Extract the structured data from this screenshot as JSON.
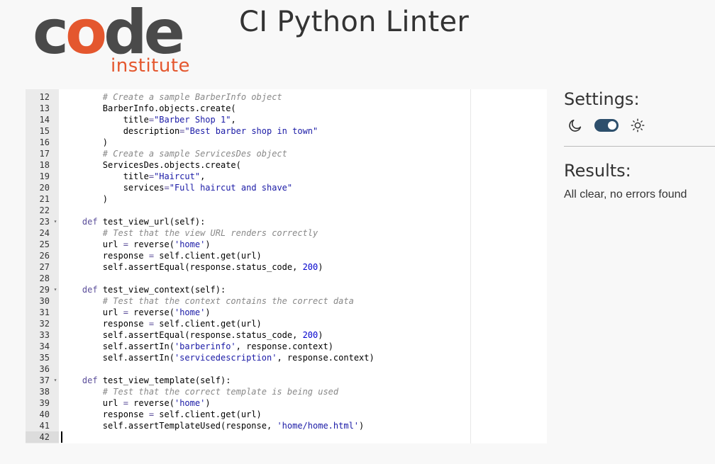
{
  "logo": {
    "word_code_prefix": "c",
    "word_code_o": "o",
    "word_code_suffix": "de",
    "word_institute": "institute"
  },
  "title": "CI Python Linter",
  "settings": {
    "heading": "Settings:",
    "dark_icon": "moon-icon",
    "light_icon": "sun-icon",
    "theme_toggle_on": true
  },
  "results": {
    "heading": "Results:",
    "message": "All clear, no errors found"
  },
  "editor": {
    "active_line": "42",
    "lines": [
      {
        "n": "12",
        "fold": "",
        "tokens": [
          {
            "t": "        "
          },
          {
            "c": "cmt",
            "t": "# Create a sample BarberInfo object"
          }
        ]
      },
      {
        "n": "13",
        "fold": "",
        "tokens": [
          {
            "t": "        BarberInfo.objects.create("
          }
        ]
      },
      {
        "n": "14",
        "fold": "",
        "tokens": [
          {
            "t": "            title"
          },
          {
            "c": "kw",
            "t": "="
          },
          {
            "c": "str",
            "t": "\"Barber Shop 1\""
          },
          {
            "t": ","
          }
        ]
      },
      {
        "n": "15",
        "fold": "",
        "tokens": [
          {
            "t": "            description"
          },
          {
            "c": "kw",
            "t": "="
          },
          {
            "c": "str",
            "t": "\"Best barber shop in town\""
          }
        ]
      },
      {
        "n": "16",
        "fold": "",
        "tokens": [
          {
            "t": "        )"
          }
        ]
      },
      {
        "n": "17",
        "fold": "",
        "tokens": [
          {
            "t": "        "
          },
          {
            "c": "cmt",
            "t": "# Create a sample ServicesDes object"
          }
        ]
      },
      {
        "n": "18",
        "fold": "",
        "tokens": [
          {
            "t": "        ServicesDes.objects.create("
          }
        ]
      },
      {
        "n": "19",
        "fold": "",
        "tokens": [
          {
            "t": "            title"
          },
          {
            "c": "kw",
            "t": "="
          },
          {
            "c": "str",
            "t": "\"Haircut\""
          },
          {
            "t": ","
          }
        ]
      },
      {
        "n": "20",
        "fold": "",
        "tokens": [
          {
            "t": "            services"
          },
          {
            "c": "kw",
            "t": "="
          },
          {
            "c": "str",
            "t": "\"Full haircut and shave\""
          }
        ]
      },
      {
        "n": "21",
        "fold": "",
        "tokens": [
          {
            "t": "        )"
          }
        ]
      },
      {
        "n": "22",
        "fold": "",
        "tokens": [
          {
            "t": ""
          }
        ]
      },
      {
        "n": "23",
        "fold": "▾",
        "tokens": [
          {
            "t": "    "
          },
          {
            "c": "kw",
            "t": "def"
          },
          {
            "t": " test_view_url(self):"
          }
        ]
      },
      {
        "n": "24",
        "fold": "",
        "tokens": [
          {
            "t": "        "
          },
          {
            "c": "cmt",
            "t": "# Test that the view URL renders correctly"
          }
        ]
      },
      {
        "n": "25",
        "fold": "",
        "tokens": [
          {
            "t": "        url "
          },
          {
            "c": "kw",
            "t": "="
          },
          {
            "t": " reverse("
          },
          {
            "c": "str",
            "t": "'home'"
          },
          {
            "t": ")"
          }
        ]
      },
      {
        "n": "26",
        "fold": "",
        "tokens": [
          {
            "t": "        response "
          },
          {
            "c": "kw",
            "t": "="
          },
          {
            "t": " self.client.get(url)"
          }
        ]
      },
      {
        "n": "27",
        "fold": "",
        "tokens": [
          {
            "t": "        self.assertEqual(response.status_code, "
          },
          {
            "c": "num",
            "t": "200"
          },
          {
            "t": ")"
          }
        ]
      },
      {
        "n": "28",
        "fold": "",
        "tokens": [
          {
            "t": ""
          }
        ]
      },
      {
        "n": "29",
        "fold": "▾",
        "tokens": [
          {
            "t": "    "
          },
          {
            "c": "kw",
            "t": "def"
          },
          {
            "t": " test_view_context(self):"
          }
        ]
      },
      {
        "n": "30",
        "fold": "",
        "tokens": [
          {
            "t": "        "
          },
          {
            "c": "cmt",
            "t": "# Test that the context contains the correct data"
          }
        ]
      },
      {
        "n": "31",
        "fold": "",
        "tokens": [
          {
            "t": "        url "
          },
          {
            "c": "kw",
            "t": "="
          },
          {
            "t": " reverse("
          },
          {
            "c": "str",
            "t": "'home'"
          },
          {
            "t": ")"
          }
        ]
      },
      {
        "n": "32",
        "fold": "",
        "tokens": [
          {
            "t": "        response "
          },
          {
            "c": "kw",
            "t": "="
          },
          {
            "t": " self.client.get(url)"
          }
        ]
      },
      {
        "n": "33",
        "fold": "",
        "tokens": [
          {
            "t": "        self.assertEqual(response.status_code, "
          },
          {
            "c": "num",
            "t": "200"
          },
          {
            "t": ")"
          }
        ]
      },
      {
        "n": "34",
        "fold": "",
        "tokens": [
          {
            "t": "        self.assertIn("
          },
          {
            "c": "str",
            "t": "'barberinfo'"
          },
          {
            "t": ", response.context)"
          }
        ]
      },
      {
        "n": "35",
        "fold": "",
        "tokens": [
          {
            "t": "        self.assertIn("
          },
          {
            "c": "str",
            "t": "'servicedescription'"
          },
          {
            "t": ", response.context)"
          }
        ]
      },
      {
        "n": "36",
        "fold": "",
        "tokens": [
          {
            "t": ""
          }
        ]
      },
      {
        "n": "37",
        "fold": "▾",
        "tokens": [
          {
            "t": "    "
          },
          {
            "c": "kw",
            "t": "def"
          },
          {
            "t": " test_view_template(self):"
          }
        ]
      },
      {
        "n": "38",
        "fold": "",
        "tokens": [
          {
            "t": "        "
          },
          {
            "c": "cmt",
            "t": "# Test that the correct template is being used"
          }
        ]
      },
      {
        "n": "39",
        "fold": "",
        "tokens": [
          {
            "t": "        url "
          },
          {
            "c": "kw",
            "t": "="
          },
          {
            "t": " reverse("
          },
          {
            "c": "str",
            "t": "'home'"
          },
          {
            "t": ")"
          }
        ]
      },
      {
        "n": "40",
        "fold": "",
        "tokens": [
          {
            "t": "        response "
          },
          {
            "c": "kw",
            "t": "="
          },
          {
            "t": " self.client.get(url)"
          }
        ]
      },
      {
        "n": "41",
        "fold": "",
        "tokens": [
          {
            "t": "        self.assertTemplateUsed(response, "
          },
          {
            "c": "str",
            "t": "'home/home.html'"
          },
          {
            "t": ")"
          }
        ]
      },
      {
        "n": "42",
        "fold": "",
        "tokens": [
          {
            "t": ""
          }
        ]
      }
    ]
  }
}
